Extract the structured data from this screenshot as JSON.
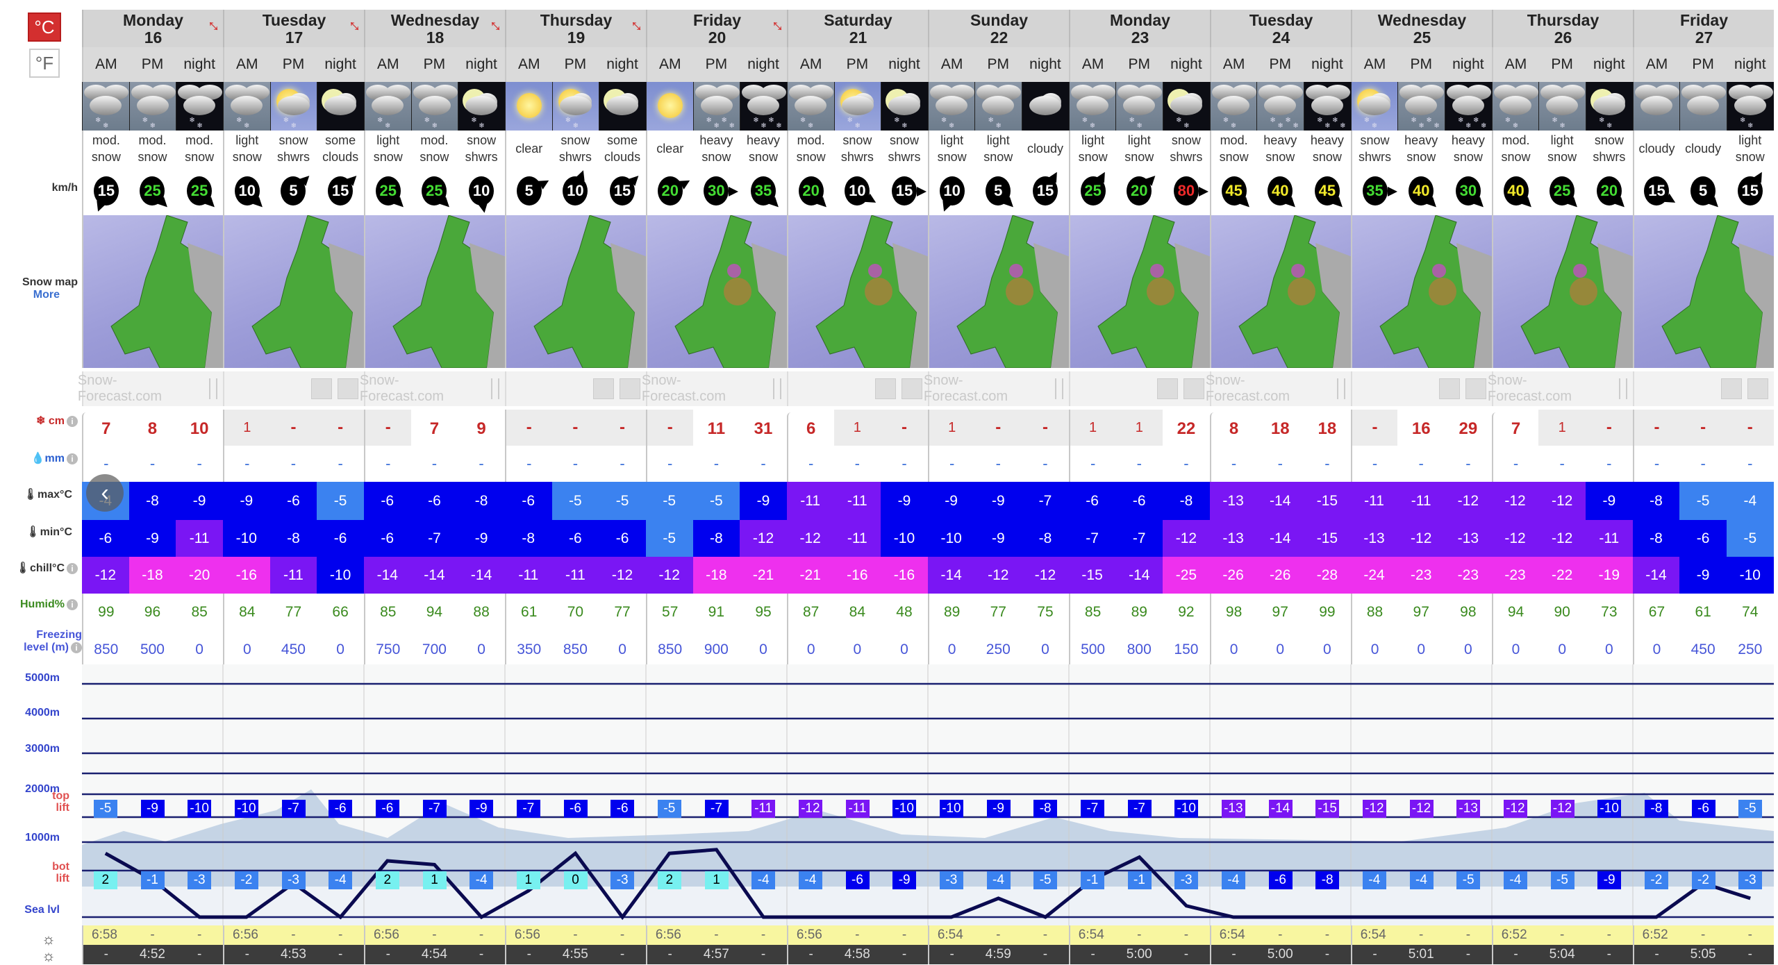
{
  "units": {
    "celsius": "°C",
    "fahrenheit": "°F",
    "active": "celsius"
  },
  "labels": {
    "wind": "km/h",
    "snow_map": "Snow map",
    "more": "More",
    "snow_cm": "cm",
    "rain_mm": "mm",
    "max": "max°C",
    "min": "min°C",
    "chill": "chill°C",
    "humid": "Humid%",
    "freezing": "Freezing level (m)",
    "h5000": "5000m",
    "h4000": "4000m",
    "h3000": "3000m",
    "h2000": "2000m",
    "top_lift": "top lift",
    "h1000": "1000m",
    "bot_lift": "bot lift",
    "sea": "Sea lvl"
  },
  "periods": [
    "AM",
    "PM",
    "night"
  ],
  "watermark": "Snow-Forecast.com",
  "days": [
    {
      "name": "Monday",
      "date": "16"
    },
    {
      "name": "Tuesday",
      "date": "17"
    },
    {
      "name": "Wednesday",
      "date": "18"
    },
    {
      "name": "Thursday",
      "date": "19"
    },
    {
      "name": "Friday",
      "date": "20"
    },
    {
      "name": "Saturday",
      "date": "21"
    },
    {
      "name": "Sunday",
      "date": "22"
    },
    {
      "name": "Monday",
      "date": "23"
    },
    {
      "name": "Tuesday",
      "date": "24"
    },
    {
      "name": "Wednesday",
      "date": "25"
    },
    {
      "name": "Thursday",
      "date": "26"
    },
    {
      "name": "Friday",
      "date": "27"
    }
  ],
  "icons": [
    "snow-day",
    "snow-day",
    "snow-night",
    "snow-day",
    "sun-cloud-snow",
    "moon-cloud",
    "snow-day",
    "snow-day",
    "moon-cloud-snow",
    "sun",
    "sun-cloud-snow",
    "moon-cloud",
    "sun",
    "heavy-snow-day",
    "heavy-snow-night",
    "snow-day",
    "sun-cloud-snow",
    "moon-cloud-snow",
    "snow-day",
    "snow-day",
    "cloud-night",
    "snow-day",
    "snow-day",
    "moon-cloud-snow",
    "snow-day",
    "heavy-snow-day",
    "heavy-snow-night",
    "sun-cloud-snow",
    "heavy-snow-day",
    "heavy-snow-night",
    "snow-day",
    "snow-day",
    "moon-cloud-snow",
    "cloudy-day",
    "cloudy-day",
    "snow-night"
  ],
  "summary": [
    "mod. snow",
    "mod. snow",
    "mod. snow",
    "light snow",
    "snow shwrs",
    "some clouds",
    "light snow",
    "mod. snow",
    "snow shwrs",
    "clear",
    "snow shwrs",
    "some clouds",
    "clear",
    "heavy snow",
    "heavy snow",
    "mod. snow",
    "snow shwrs",
    "snow shwrs",
    "light snow",
    "light snow",
    "cloudy",
    "light snow",
    "light snow",
    "snow shwrs",
    "mod. snow",
    "heavy snow",
    "heavy snow",
    "snow shwrs",
    "heavy snow",
    "heavy snow",
    "mod. snow",
    "light snow",
    "snow shwrs",
    "cloudy",
    "cloudy",
    "light snow"
  ],
  "wind_speed": [
    "15",
    "25",
    "25",
    "10",
    "5",
    "15",
    "25",
    "25",
    "10",
    "5",
    "10",
    "15",
    "20",
    "30",
    "35",
    "20",
    "10",
    "15",
    "10",
    "5",
    "15",
    "25",
    "20",
    "80",
    "45",
    "40",
    "45",
    "35",
    "40",
    "30",
    "40",
    "25",
    "20",
    "15",
    "5",
    "15"
  ],
  "wind_dir_deg": [
    200,
    135,
    135,
    135,
    45,
    45,
    135,
    135,
    170,
    60,
    20,
    45,
    60,
    90,
    135,
    135,
    120,
    90,
    200,
    135,
    30,
    30,
    45,
    90,
    135,
    135,
    135,
    90,
    135,
    135,
    135,
    135,
    135,
    120,
    135,
    30
  ],
  "snow_cm": [
    "7",
    "8",
    "10",
    "1",
    "-",
    "-",
    "-",
    "7",
    "9",
    "-",
    "-",
    "-",
    "-",
    "11",
    "31",
    "6",
    "1",
    "-",
    "1",
    "-",
    "-",
    "1",
    "1",
    "22",
    "8",
    "18",
    "18",
    "-",
    "16",
    "29",
    "7",
    "1",
    "-",
    "-",
    "-",
    "-"
  ],
  "rain_mm": [
    "-",
    "-",
    "-",
    "-",
    "-",
    "-",
    "-",
    "-",
    "-",
    "-",
    "-",
    "-",
    "-",
    "-",
    "-",
    "-",
    "-",
    "-",
    "-",
    "-",
    "-",
    "-",
    "-",
    "-",
    "-",
    "-",
    "-",
    "-",
    "-",
    "-",
    "-",
    "-",
    "-",
    "-",
    "-",
    "-"
  ],
  "max_c": [
    "-4",
    "-8",
    "-9",
    "-9",
    "-6",
    "-5",
    "-6",
    "-6",
    "-8",
    "-6",
    "-5",
    "-5",
    "-5",
    "-5",
    "-9",
    "-11",
    "-11",
    "-9",
    "-9",
    "-9",
    "-7",
    "-6",
    "-6",
    "-8",
    "-13",
    "-14",
    "-15",
    "-11",
    "-11",
    "-12",
    "-12",
    "-12",
    "-9",
    "-8",
    "-5",
    "-4"
  ],
  "min_c": [
    "-6",
    "-9",
    "-11",
    "-10",
    "-8",
    "-6",
    "-6",
    "-7",
    "-9",
    "-8",
    "-6",
    "-6",
    "-5",
    "-8",
    "-12",
    "-12",
    "-11",
    "-10",
    "-10",
    "-9",
    "-8",
    "-7",
    "-7",
    "-12",
    "-13",
    "-14",
    "-15",
    "-13",
    "-12",
    "-13",
    "-12",
    "-12",
    "-11",
    "-8",
    "-6",
    "-5"
  ],
  "chill_c": [
    "-12",
    "-18",
    "-20",
    "-16",
    "-11",
    "-10",
    "-14",
    "-14",
    "-14",
    "-11",
    "-11",
    "-12",
    "-12",
    "-18",
    "-21",
    "-21",
    "-16",
    "-16",
    "-14",
    "-12",
    "-12",
    "-15",
    "-14",
    "-25",
    "-26",
    "-26",
    "-28",
    "-24",
    "-23",
    "-23",
    "-23",
    "-22",
    "-19",
    "-14",
    "-9",
    "-10"
  ],
  "humidity": [
    "99",
    "96",
    "85",
    "84",
    "77",
    "66",
    "85",
    "94",
    "88",
    "61",
    "70",
    "77",
    "57",
    "91",
    "95",
    "87",
    "84",
    "48",
    "89",
    "77",
    "75",
    "85",
    "89",
    "92",
    "98",
    "97",
    "99",
    "88",
    "97",
    "98",
    "94",
    "90",
    "73",
    "67",
    "61",
    "74"
  ],
  "freezing_m": [
    "850",
    "500",
    "0",
    "0",
    "450",
    "0",
    "750",
    "700",
    "0",
    "350",
    "850",
    "0",
    "850",
    "900",
    "0",
    "0",
    "0",
    "0",
    "0",
    "250",
    "0",
    "500",
    "800",
    "150",
    "0",
    "0",
    "0",
    "0",
    "0",
    "0",
    "0",
    "0",
    "0",
    "0",
    "450",
    "250"
  ],
  "top_lift_c": [
    "-5",
    "-9",
    "-10",
    "-10",
    "-7",
    "-6",
    "-6",
    "-7",
    "-9",
    "-7",
    "-6",
    "-6",
    "-5",
    "-7",
    "-11",
    "-12",
    "-11",
    "-10",
    "-10",
    "-9",
    "-8",
    "-7",
    "-7",
    "-10",
    "-13",
    "-14",
    "-15",
    "-12",
    "-12",
    "-13",
    "-12",
    "-12",
    "-10",
    "-8",
    "-6",
    "-5"
  ],
  "bot_lift_c": [
    "2",
    "-1",
    "-3",
    "-2",
    "-3",
    "-4",
    "2",
    "1",
    "-4",
    "1",
    "0",
    "-3",
    "2",
    "1",
    "-4",
    "-4",
    "-6",
    "-9",
    "-3",
    "-4",
    "-5",
    "-1",
    "-1",
    "-3",
    "-4",
    "-6",
    "-8",
    "-4",
    "-4",
    "-5",
    "-4",
    "-5",
    "-9",
    "-2",
    "-2",
    "-3"
  ],
  "sunrise": [
    "6:58",
    "6:56",
    "6:56",
    "6:56",
    "6:56",
    "6:56",
    "6:54",
    "6:54",
    "6:54",
    "6:54",
    "6:52",
    "6:52"
  ],
  "sunset": [
    "4:52",
    "4:53",
    "4:54",
    "4:55",
    "4:57",
    "4:58",
    "4:59",
    "5:00",
    "5:00",
    "5:01",
    "5:04",
    "5:05"
  ],
  "placeholder_dash": "-",
  "colors": {
    "temp_cyan": "#77f0f0",
    "temp_lightblue": "#3b82f0",
    "temp_blue": "#0000ee",
    "temp_purple": "#7a16f4",
    "temp_magenta": "#ee30ee",
    "wind_white": "#ffffff",
    "wind_green": "#44dd33",
    "wind_yellow": "#f2ea2a",
    "wind_red": "#ee2a2a",
    "humidity": "#3a8a1e",
    "freezing": "#4655d8",
    "snow": "#c62828",
    "celsius_active": "#d32f2f"
  }
}
